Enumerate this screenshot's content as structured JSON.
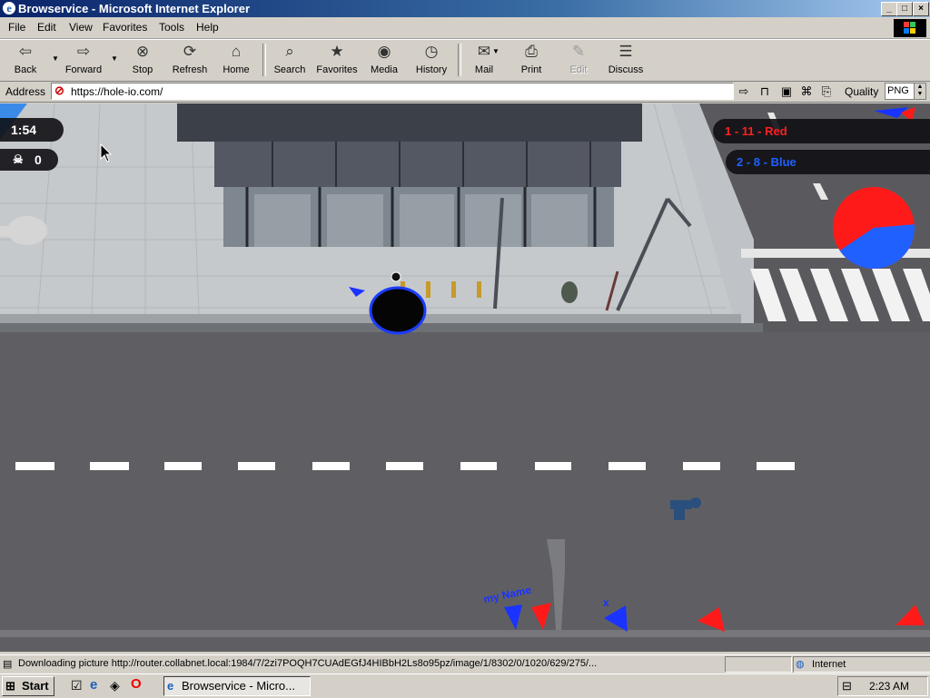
{
  "window": {
    "title": "Browservice - Microsoft Internet Explorer",
    "controls": {
      "minimize": "_",
      "maximize": "□",
      "close": "×"
    }
  },
  "menu": {
    "items": [
      {
        "label": "File"
      },
      {
        "label": "Edit"
      },
      {
        "label": "View"
      },
      {
        "label": "Favorites"
      },
      {
        "label": "Tools"
      },
      {
        "label": "Help"
      }
    ]
  },
  "toolbar": {
    "back": {
      "label": "Back",
      "icon": "back-arrow-icon"
    },
    "forward": {
      "label": "Forward",
      "icon": "forward-arrow-icon"
    },
    "stop": {
      "label": "Stop",
      "icon": "stop-icon"
    },
    "refresh": {
      "label": "Refresh",
      "icon": "refresh-icon"
    },
    "home": {
      "label": "Home",
      "icon": "home-icon"
    },
    "search": {
      "label": "Search",
      "icon": "search-icon"
    },
    "favorites": {
      "label": "Favorites",
      "icon": "favorites-icon"
    },
    "media": {
      "label": "Media",
      "icon": "media-icon"
    },
    "history": {
      "label": "History",
      "icon": "history-icon"
    },
    "mail": {
      "label": "Mail",
      "icon": "mail-icon"
    },
    "print": {
      "label": "Print",
      "icon": "print-icon"
    },
    "edit": {
      "label": "Edit",
      "icon": "edit-icon",
      "disabled": true
    },
    "discuss": {
      "label": "Discuss",
      "icon": "discuss-icon"
    }
  },
  "address": {
    "label": "Address",
    "url": "https://hole-io.com/",
    "quality_label": "Quality",
    "quality_value": "PNG"
  },
  "game": {
    "timer": "1:54",
    "kills": "0",
    "teams": [
      {
        "text": "1 - 11 - Red",
        "color": "#ff2020"
      },
      {
        "text": "2 - 8 - Blue",
        "color": "#2060ff"
      }
    ],
    "pie_share": {
      "red": 0.58,
      "blue": 0.42
    },
    "player_labels": [
      {
        "text": "my Name",
        "color": "#1a33ff"
      },
      {
        "text": "x",
        "color": "#1a33ff"
      }
    ]
  },
  "status": {
    "text": "Downloading picture http://router.collabnet.local:1984/7/2zi7POQH7CUAdEGfJ4HIBbH2Ls8o95pz/image/1/8302/0/1020/629/275/...",
    "zone": "Internet"
  },
  "taskbar": {
    "start": "Start",
    "task": "Browservice - Micro...",
    "clock": "2:23 AM"
  },
  "colors": {
    "titlebar": "#0a246a",
    "team_red": "#ff2020",
    "team_blue": "#2060ff"
  }
}
